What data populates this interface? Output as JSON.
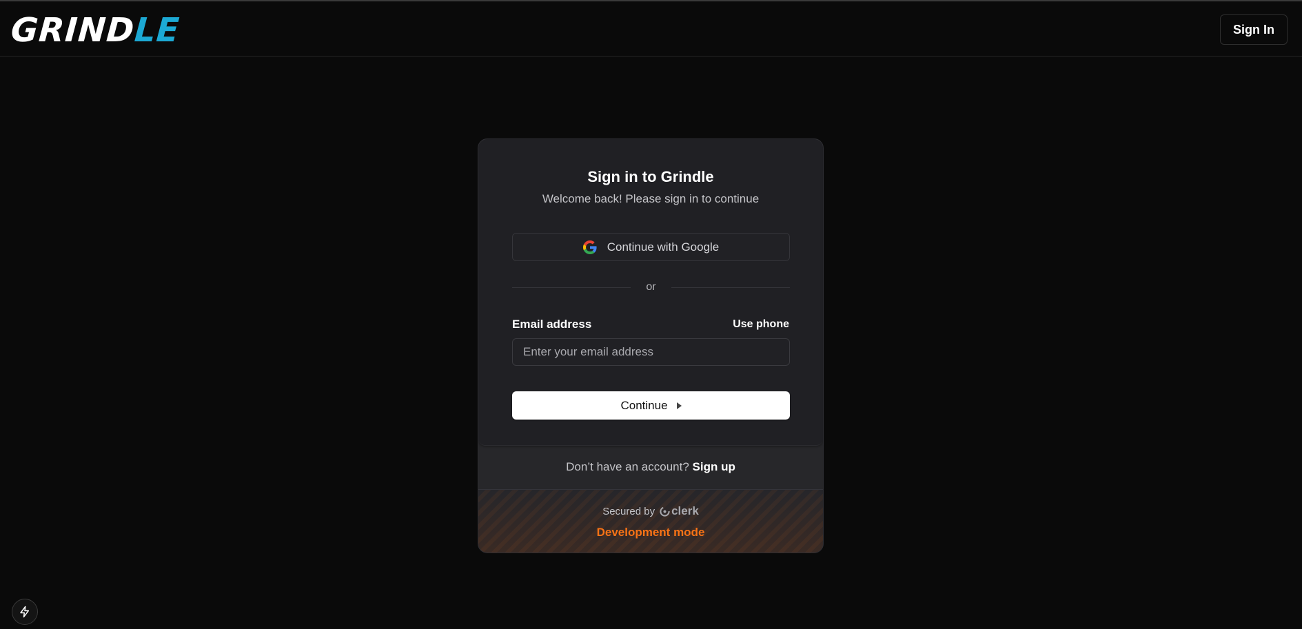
{
  "header": {
    "logo_part1": "GRIND",
    "logo_part2": "LE",
    "signin_label": "Sign In"
  },
  "card": {
    "title": "Sign in to Grindle",
    "subtitle": "Welcome back! Please sign in to continue",
    "google_label": "Continue with Google",
    "divider_text": "or",
    "email_label": "Email address",
    "use_phone_label": "Use phone",
    "email_placeholder": "Enter your email address",
    "email_value": "",
    "continue_label": "Continue",
    "signup_prompt": "Don’t have an account?",
    "signup_link": "Sign up",
    "secured_by": "Secured by",
    "clerk_brand": "clerk",
    "dev_mode": "Development mode"
  },
  "icons": {
    "google": "google-icon",
    "continue_arrow": "caret-right-icon",
    "clerk": "clerk-logo-icon",
    "bolt": "lightning-bolt-icon"
  },
  "colors": {
    "background": "#0a0a0a",
    "card": "#202024",
    "logo_accent": "#1ca9d4",
    "dev_mode": "#f97316"
  }
}
